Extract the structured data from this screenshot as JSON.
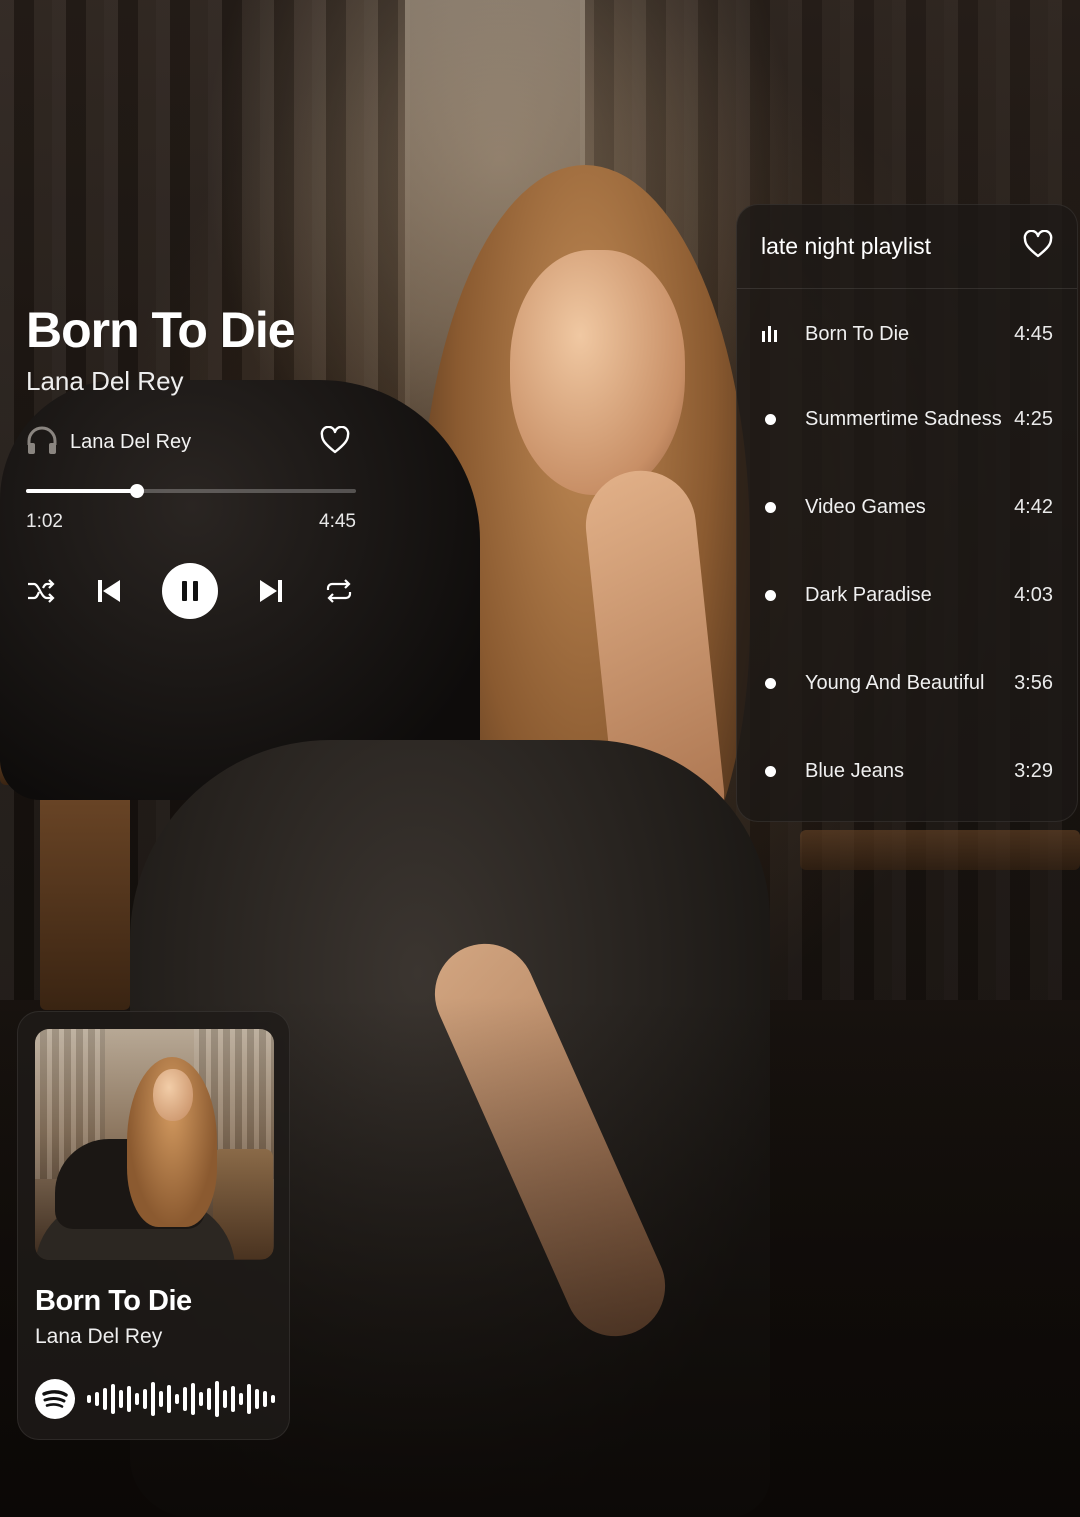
{
  "player": {
    "title": "Born To Die",
    "artist": "Lana Del Rey",
    "device_label": "Lana Del Rey",
    "elapsed": "1:02",
    "duration": "4:45",
    "progress_fraction": 0.335
  },
  "playlist": {
    "title": "late night playlist",
    "tracks": [
      {
        "name": "Born To Die",
        "duration": "4:45",
        "playing": true
      },
      {
        "name": "Summertime Sadness",
        "duration": "4:25",
        "playing": false
      },
      {
        "name": "Video Games",
        "duration": "4:42",
        "playing": false
      },
      {
        "name": "Dark Paradise",
        "duration": "4:03",
        "playing": false
      },
      {
        "name": "Young And Beautiful",
        "duration": "3:56",
        "playing": false
      },
      {
        "name": "Blue Jeans",
        "duration": "3:29",
        "playing": false
      }
    ]
  },
  "card": {
    "title": "Born To Die",
    "artist": "Lana Del Rey"
  },
  "icons": [
    "headphones-icon",
    "heart-icon",
    "shuffle-icon",
    "previous-icon",
    "pause-icon",
    "next-icon",
    "repeat-icon",
    "equalizer-icon",
    "spotify-icon"
  ],
  "colors": {
    "text": "#ffffff",
    "panel": "#1c1816",
    "accent": "#ffffff"
  }
}
